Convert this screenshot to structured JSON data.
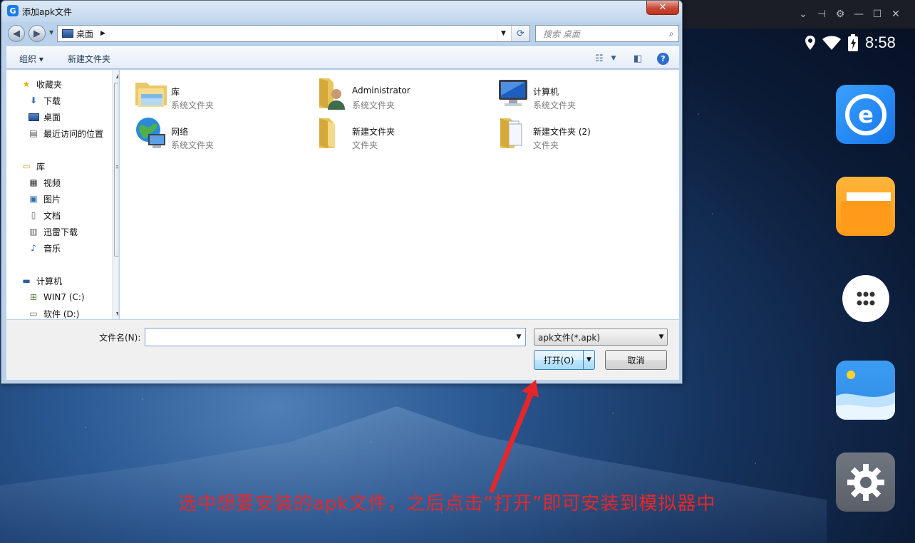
{
  "dialog": {
    "title": "添加apk文件",
    "close_label": "✕",
    "address": {
      "location": "桌面"
    },
    "search": {
      "placeholder": "搜索 桌面"
    },
    "toolbar": {
      "organize": "组织 ▾",
      "new_folder": "新建文件夹"
    },
    "nav": {
      "favorites": "收藏夹",
      "downloads": "下载",
      "desktop": "桌面",
      "recent": "最近访问的位置",
      "libraries": "库",
      "videos": "视频",
      "pictures": "图片",
      "documents": "文档",
      "xunlei": "迅雷下载",
      "music": "音乐",
      "computer": "计算机",
      "drive_c": "WIN7 (C:)",
      "drive_d": "软件 (D:)"
    },
    "files": [
      {
        "name": "库",
        "type": "系统文件夹"
      },
      {
        "name": "Administrator",
        "type": "系统文件夹"
      },
      {
        "name": "计算机",
        "type": "系统文件夹"
      },
      {
        "name": "网络",
        "type": "系统文件夹"
      },
      {
        "name": "新建文件夹",
        "type": "文件夹"
      },
      {
        "name": "新建文件夹 (2)",
        "type": "文件夹"
      }
    ],
    "filename_label": "文件名(N):",
    "filename_value": "",
    "filetype": "apk文件(*.apk)",
    "open_label": "打开(O)",
    "cancel_label": "取消"
  },
  "status": {
    "time": "8:58"
  },
  "annotation": "选中想要安装的apk文件，之后点击“打开”即可安装到模拟器中",
  "colors": {
    "annotation": "#e8262a",
    "desktop_bg": "#16345f"
  }
}
